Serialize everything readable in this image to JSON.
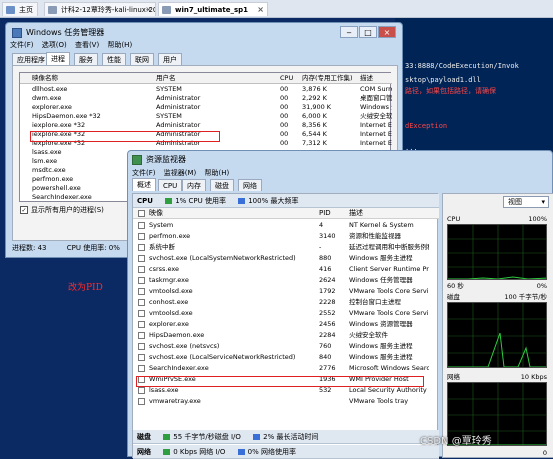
{
  "host_tabs": [
    {
      "label": "主页"
    },
    {
      "label": "计科2-12覃玲秀-kali-linux-20..."
    },
    {
      "label": "win7_ultimate_sp1"
    }
  ],
  "terminal": {
    "lines": [
      {
        "text": "33:8888/CodeExecution/Invok",
        "red": false
      },
      {
        "text": "sktop\\payload1.dll",
        "red": false
      },
      {
        "text": "路径，如果包括路径，请确保",
        "red": true
      },
      {
        "text": "dException",
        "red": true
      },
      {
        "text": "...",
        "red": false
      }
    ]
  },
  "task_manager": {
    "title": "Windows 任务管理器",
    "menu": [
      "文件(F)",
      "选项(O)",
      "查看(V)",
      "帮助(H)"
    ],
    "tabs": [
      "应用程序",
      "进程",
      "服务",
      "性能",
      "联网",
      "用户"
    ],
    "active_tab": 1,
    "columns": [
      "映像名称",
      "用户名",
      "CPU",
      "内存(专用工作集)",
      "描述"
    ],
    "rows": [
      [
        "dllhost.exe",
        "SYSTEM",
        "00",
        "3,876 K",
        "COM Surro"
      ],
      [
        "dwm.exe",
        "Administrator",
        "00",
        "2,292 K",
        "桌面窗口管"
      ],
      [
        "explorer.exe",
        "Administrator",
        "00",
        "31,900 K",
        "Windows 资"
      ],
      [
        "HipsDaemon.exe *32",
        "SYSTEM",
        "00",
        "6,000 K",
        "火绒安全软"
      ],
      [
        "iexplore.exe *32",
        "Administrator",
        "00",
        "8,356 K",
        "Internet E"
      ],
      [
        "iexplore.exe *32",
        "Administrator",
        "00",
        "6,544 K",
        "Internet E"
      ],
      [
        "iexplore.exe *32",
        "Administrator",
        "00",
        "7,312 K",
        "Internet E"
      ],
      [
        "lsass.exe",
        "",
        "",
        "",
        ""
      ],
      [
        "lsm.exe",
        "",
        "",
        "",
        ""
      ],
      [
        "msdtc.exe",
        "",
        "",
        "",
        ""
      ],
      [
        "perfmon.exe",
        "",
        "",
        "",
        ""
      ],
      [
        "powershell.exe",
        "",
        "",
        "",
        ""
      ],
      [
        "SearchIndexer.exe",
        "",
        "",
        "",
        ""
      ]
    ],
    "show_all_label": "显示所有用户的进程(S)",
    "status_processes": "进程数: 43",
    "status_cpu": "CPU 使用率: 0%"
  },
  "annotation": "改为PID",
  "resource_monitor": {
    "title": "资源监视器",
    "menu": [
      "文件(F)",
      "监视器(M)",
      "帮助(H)"
    ],
    "tabs": [
      "概述",
      "CPU",
      "内存",
      "磁盘",
      "网络"
    ],
    "cpu_section": {
      "name": "CPU",
      "usage": "1% CPU 使用率",
      "freq": "100% 最大频率"
    },
    "columns": [
      "映像",
      "PID",
      "描述"
    ],
    "rows": [
      [
        "System",
        "4",
        "NT Kernel & System"
      ],
      [
        "perfmon.exe",
        "3140",
        "资源和性能监视器"
      ],
      [
        "系统中断",
        "-",
        "延迟过程调用和中断服务例程"
      ],
      [
        "svchost.exe (LocalSystemNetworkRestricted)",
        "880",
        "Windows 服务主进程"
      ],
      [
        "csrss.exe",
        "416",
        "Client Server Runtime Process"
      ],
      [
        "taskmgr.exe",
        "2624",
        "Windows 任务管理器"
      ],
      [
        "vmtoolsd.exe",
        "1792",
        "VMware Tools Core Service"
      ],
      [
        "conhost.exe",
        "2228",
        "控制台窗口主进程"
      ],
      [
        "vmtoolsd.exe",
        "2552",
        "VMware Tools Core Service"
      ],
      [
        "explorer.exe",
        "2456",
        "Windows 资源管理器"
      ],
      [
        "HipsDaemon.exe",
        "2284",
        "火绒安全软件"
      ],
      [
        "svchost.exe (netsvcs)",
        "760",
        "Windows 服务主进程"
      ],
      [
        "svchost.exe (LocalServiceNetworkRestricted)",
        "840",
        "Windows 服务主进程"
      ],
      [
        "SearchIndexer.exe",
        "2776",
        "Microsoft Windows Search"
      ],
      [
        "WmiPrvSE.exe",
        "1936",
        "WMI Provider Host"
      ],
      [
        "lsass.exe",
        "532",
        "Local Security Authority"
      ],
      [
        "vmwaretray.exe",
        "",
        "VMware Tools tray"
      ]
    ],
    "disk_section": {
      "name": "磁盘",
      "io": "55 千字节/秒磁盘 I/O",
      "active": "2% 最长活动时间"
    },
    "network_section": {
      "name": "网络",
      "io": "0 Kbps 网络 I/O",
      "util": "0% 网络使用率"
    },
    "view_label": "视图",
    "graphs": [
      {
        "name": "CPU",
        "right": "100%",
        "left_bottom": "60 秒",
        "right_bottom": "0%"
      },
      {
        "name": "磁盘",
        "right": "100 千字节/秒",
        "left_bottom": "",
        "right_bottom": ""
      },
      {
        "name": "网络",
        "right": "10 Kbps",
        "left_bottom": "",
        "right_bottom": "0"
      }
    ]
  },
  "watermark": "CSDN @覃玲秀",
  "colors": {
    "accent": "#0b2a63",
    "terminal_bg": "#012456",
    "highlight": "#e02020",
    "graph_green": "#2ecc40"
  }
}
